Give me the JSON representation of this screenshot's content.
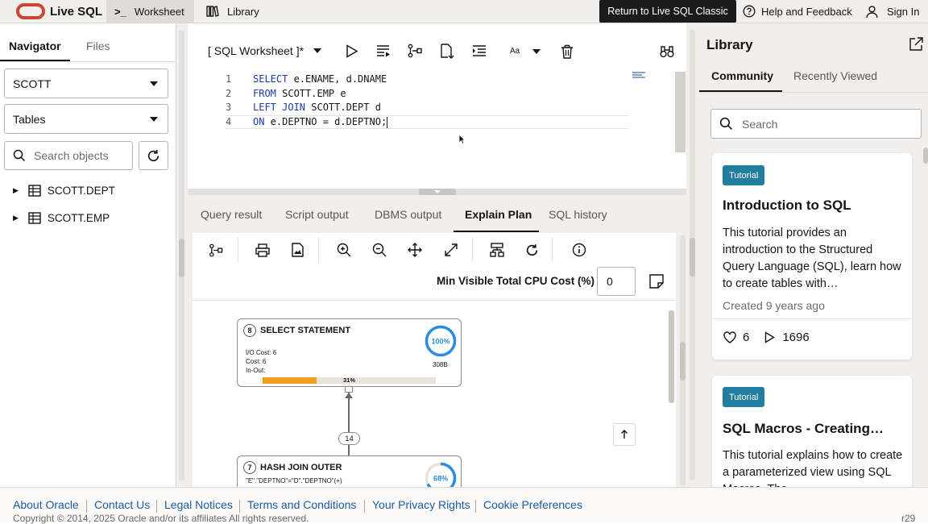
{
  "topbar": {
    "brand": "Live SQL",
    "worksheet": "Worksheet",
    "library": "Library",
    "classic_button": "Return to Live SQL Classic",
    "help": "Help and Feedback",
    "signin": "Sign In"
  },
  "navigator": {
    "tabs": [
      "Navigator",
      "Files"
    ],
    "schema": "SCOTT",
    "object_type": "Tables",
    "search_placeholder": "Search objects",
    "tree": [
      "SCOTT.DEPT",
      "SCOTT.EMP"
    ]
  },
  "worksheet": {
    "title": "[ SQL Worksheet ]*",
    "font_label": "Aa",
    "lines": [
      {
        "n": "1",
        "kw": "SELECT",
        "rest": " e.ENAME, d.DNAME"
      },
      {
        "n": "2",
        "kw": "FROM",
        "rest": " SCOTT.EMP e"
      },
      {
        "n": "3",
        "kw": "LEFT JOIN",
        "rest": " SCOTT.DEPT d"
      },
      {
        "n": "4",
        "kw": "ON",
        "rest": " e.DEPTNO = d.DEPTNO;"
      }
    ]
  },
  "results": {
    "tabs": [
      "Query result",
      "Script output",
      "DBMS output",
      "Explain Plan",
      "SQL history"
    ],
    "active_tab": "Explain Plan",
    "min_cost_label": "Min Visible Total CPU Cost (%)",
    "min_cost_value": "0",
    "plan": {
      "node1": {
        "id": "8",
        "title": "SELECT STATEMENT",
        "io": "I/O Cost: 6",
        "cost": "Cost: 6",
        "inout": "In-Out:",
        "bar_pct": "31%",
        "bar_fraction": 0.31,
        "ring": "100%",
        "ring_fraction": 1.0,
        "bytes": "308B"
      },
      "edge_label": "14",
      "node2": {
        "id": "7",
        "title": "HASH JOIN OUTER",
        "predicate": "\"E\".\"DEPTNO\"=\"D\".\"DEPTNO\"(+)",
        "ring": "68%",
        "ring_fraction": 0.68
      }
    }
  },
  "library": {
    "title": "Library",
    "tabs": [
      "Community",
      "Recently Viewed"
    ],
    "search_placeholder": "Search",
    "cards": [
      {
        "tag": "Tutorial",
        "title": "Introduction to SQL",
        "desc": "This tutorial provides an introduction to the Structured Query Language (SQL), learn how to create tables with…",
        "created": "Created 9 years ago",
        "likes": "6",
        "views": "1696"
      },
      {
        "tag": "Tutorial",
        "title": "SQL Macros - Creating…",
        "desc": "This tutorial explains how to create a parameterized view using SQL Macros. The…"
      }
    ]
  },
  "footer": {
    "links": [
      "About Oracle",
      "Contact Us",
      "Legal Notices",
      "Terms and Conditions",
      "Your Privacy Rights",
      "Cookie Preferences"
    ],
    "copyright": "Copyright © 2014, 2025 Oracle and/or its affiliates All rights reserved.",
    "version": "r29"
  },
  "colors": {
    "brand_red": "#c74634",
    "accent_blue": "#227e9e",
    "progress_orange": "#f0a01e",
    "ring_blue": "#2a8ddf"
  }
}
